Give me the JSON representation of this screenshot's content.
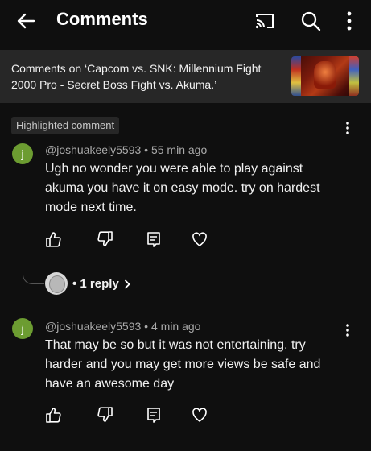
{
  "appbar": {
    "title": "Comments",
    "back_icon": "back-arrow-icon",
    "cast_icon": "cast-icon",
    "search_icon": "search-icon",
    "more_icon": "more-vert-icon"
  },
  "context": {
    "text": "Comments on ‘Capcom vs. SNK: Millennium Fight 2000 Pro - Secret Boss Fight vs. Akuma.’"
  },
  "highlighted_label": "Highlighted comment",
  "comments": [
    {
      "avatar_letter": "j",
      "avatar_color": "#6c9c31",
      "meta": "@joshuakeely5593 • 55 min ago",
      "text": "Ugh no wonder you were able to play against akuma you have it on easy mode. try on hardest mode next time.",
      "reply_count_label": "• 1 reply"
    },
    {
      "avatar_letter": "j",
      "avatar_color": "#6c9c31",
      "meta": "@joshuakeely5593 • 4 min ago",
      "text": "That may be so but it was not entertaining, try harder and you may get more views be safe and have an awesome day"
    }
  ],
  "actions": [
    "like-icon",
    "dislike-icon",
    "reply-icon",
    "heart-icon"
  ]
}
